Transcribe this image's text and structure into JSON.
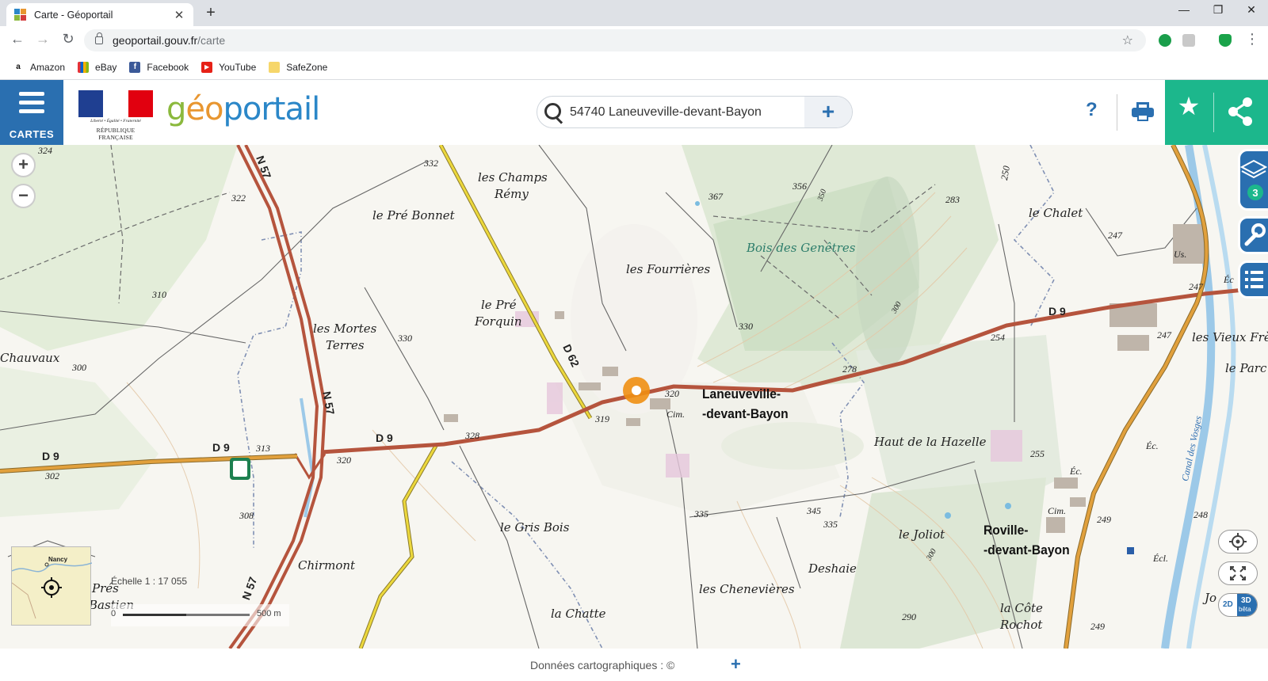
{
  "browser": {
    "tab_title": "Carte - Géoportail",
    "url_host": "geoportail.gouv.fr",
    "url_path": "/carte",
    "bookmarks": [
      {
        "label": "Amazon",
        "icon": "amazon-icon"
      },
      {
        "label": "eBay",
        "icon": "ebay-icon"
      },
      {
        "label": "Facebook",
        "icon": "facebook-icon"
      },
      {
        "label": "YouTube",
        "icon": "youtube-icon"
      },
      {
        "label": "SafeZone",
        "icon": "folder-icon"
      }
    ]
  },
  "header": {
    "menu_label": "CARTES",
    "logo_text": {
      "g": "g",
      "e": "éo",
      "rest": "portail"
    },
    "republic_motto": "Liberté • Égalité • Fraternité",
    "republic_name": "RÉPUBLIQUE FRANÇAISE",
    "search_query": "54740 Laneuveville-devant-Bayon",
    "help_label": "?"
  },
  "map": {
    "place_labels": [
      {
        "text": "les Champs"
      },
      {
        "text": "Rémy"
      },
      {
        "text": "le Pré Bonnet"
      },
      {
        "text": "les Fourrières"
      },
      {
        "text": "Bois des Genêtres"
      },
      {
        "text": "le Chalet"
      },
      {
        "text": "le Pré"
      },
      {
        "text": "Forquin"
      },
      {
        "text": "les Mortes"
      },
      {
        "text": "Terres"
      },
      {
        "text": "Chauvaux"
      },
      {
        "text": "Haut de la Hazelle"
      },
      {
        "text": "le Gris Bois"
      },
      {
        "text": "Chirmont"
      },
      {
        "text": "le Joliot"
      },
      {
        "text": "Deshaie"
      },
      {
        "text": "les Chenevières"
      },
      {
        "text": "la Chatte"
      },
      {
        "text": "la Côte"
      },
      {
        "text": "Rochot"
      },
      {
        "text": "les Vieux Frère"
      },
      {
        "text": "le Parc"
      },
      {
        "text": "Prés"
      },
      {
        "text": "Bastien"
      },
      {
        "text": "Jo"
      }
    ],
    "towns": [
      {
        "line1": "Laneuveville-",
        "line2": "-devant-Bayon"
      },
      {
        "line1": "Roville-",
        "line2": "-devant-Bayon"
      }
    ],
    "roads": [
      "N 57",
      "N 57",
      "N 57",
      "D 9",
      "D 9",
      "D 9",
      "D 9",
      "D 62"
    ],
    "altitudes": [
      "324",
      "322",
      "332",
      "367",
      "356",
      "283",
      "250",
      "247",
      "310",
      "330",
      "330",
      "300",
      "320",
      "319",
      "328",
      "313",
      "320",
      "302",
      "308",
      "278",
      "254",
      "247",
      "247",
      "255",
      "335",
      "345",
      "335",
      "249",
      "248",
      "290",
      "249",
      "350",
      "300",
      "300"
    ],
    "small_labels": [
      "Cim.",
      "Cim.",
      "Éc.",
      "Éc.",
      "Écl.",
      "Éc",
      "Us.",
      "Canal des Vosges"
    ],
    "layers_badge": "3",
    "mode_2d": "2D",
    "mode_3d": "3D",
    "mode_3d_sub": "bêta",
    "minimap_label": "Nancy",
    "scale_text": "Échelle 1 : 17 055",
    "scale_zero": "0",
    "scale_distance": "500 m"
  },
  "footer": {
    "credit": "Données cartographiques : ©"
  },
  "colors": {
    "brand_blue": "#2a6fb0",
    "brand_green": "#1cb78c",
    "road_red": "#b5543d",
    "road_orange": "#e1a03c",
    "road_yellow": "#ecd83c"
  }
}
